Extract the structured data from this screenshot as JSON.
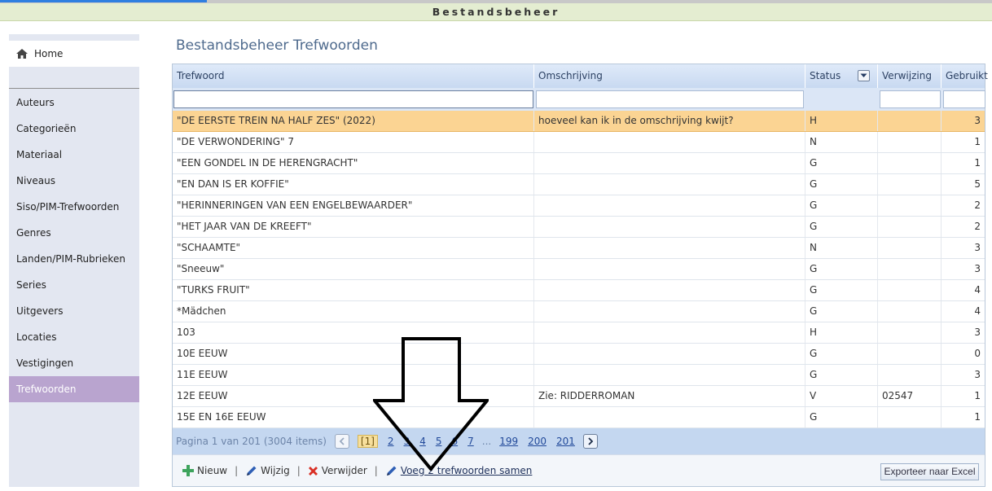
{
  "app": {
    "title": "Bestandsbeheer"
  },
  "sidebar": {
    "home_label": "Home",
    "items": [
      {
        "label": "Auteurs"
      },
      {
        "label": "Categorieën"
      },
      {
        "label": "Materiaal"
      },
      {
        "label": "Niveaus"
      },
      {
        "label": "Siso/PIM-Trefwoorden"
      },
      {
        "label": "Genres"
      },
      {
        "label": "Landen/PIM-Rubrieken"
      },
      {
        "label": "Series"
      },
      {
        "label": "Uitgevers"
      },
      {
        "label": "Locaties"
      },
      {
        "label": "Vestigingen"
      },
      {
        "label": "Trefwoorden",
        "active": true
      }
    ]
  },
  "main": {
    "title": "Bestandsbeheer Trefwoorden"
  },
  "grid": {
    "columns": [
      "Trefwoord",
      "Omschrijving",
      "Status",
      "Verwijzing",
      "Gebruikt"
    ],
    "filters": {
      "trefwoord": "",
      "omschrijving": "",
      "verwijzing": "",
      "gebruikt": ""
    },
    "rows": [
      [
        "\"DE EERSTE TREIN NA HALF ZES\" (2022)",
        "hoeveel kan ik in de omschrijving kwijt?",
        "H",
        "",
        "3"
      ],
      [
        "\"DE VERWONDERING\" 7",
        "",
        "N",
        "",
        "1"
      ],
      [
        "\"EEN GONDEL IN DE HERENGRACHT\"",
        "",
        "G",
        "",
        "1"
      ],
      [
        "\"EN DAN IS ER KOFFIE\"",
        "",
        "G",
        "",
        "5"
      ],
      [
        "\"HERINNERINGEN VAN EEN ENGELBEWAARDER\"",
        "",
        "G",
        "",
        "2"
      ],
      [
        "\"HET JAAR VAN DE KREEFT\"",
        "",
        "G",
        "",
        "2"
      ],
      [
        "\"SCHAAMTE\"",
        "",
        "N",
        "",
        "3"
      ],
      [
        "\"Sneeuw\"",
        "",
        "G",
        "",
        "3"
      ],
      [
        "\"TURKS FRUIT\"",
        "",
        "G",
        "",
        "4"
      ],
      [
        "*Mädchen",
        "",
        "G",
        "",
        "4"
      ],
      [
        "103",
        "",
        "H",
        "",
        "3"
      ],
      [
        "10E EEUW",
        "",
        "G",
        "",
        "0"
      ],
      [
        "11E EEUW",
        "",
        "G",
        "",
        "3"
      ],
      [
        "12E EEUW",
        "Zie: RIDDERROMAN",
        "V",
        "02547",
        "1"
      ],
      [
        "15E EN 16E EEUW",
        "",
        "G",
        "",
        "1"
      ]
    ],
    "selected_row": 0
  },
  "pager": {
    "info": "Pagina 1 van 201 (3004 items)",
    "pages": [
      "[1]",
      "2",
      "3",
      "4",
      "5",
      "6",
      "7",
      "...",
      "199",
      "200",
      "201"
    ],
    "current_index": 0
  },
  "toolbar": {
    "new_label": "Nieuw",
    "edit_label": "Wijzig",
    "delete_label": "Verwijder",
    "merge_label": "Voeg 2 trefwoorden samen",
    "export_label": "Exporteer naar Excel"
  },
  "colors": {
    "title_bar": "#e4edd1",
    "sidebar_bg": "#e3e7f1",
    "sidebar_active": "#b9a4cf",
    "selected_row": "#fbd493",
    "pager_bg": "#c4d7f0",
    "header_text": "#4e6a8d"
  },
  "icons": {
    "home": "home-icon",
    "status_filter": "dropdown-filter-icon",
    "new": "plus-icon",
    "edit": "pencil-icon",
    "delete": "x-icon",
    "merge": "pencil-icon",
    "prev": "chevron-left-icon",
    "next": "chevron-right-icon",
    "annotation": "down-arrow-icon"
  }
}
